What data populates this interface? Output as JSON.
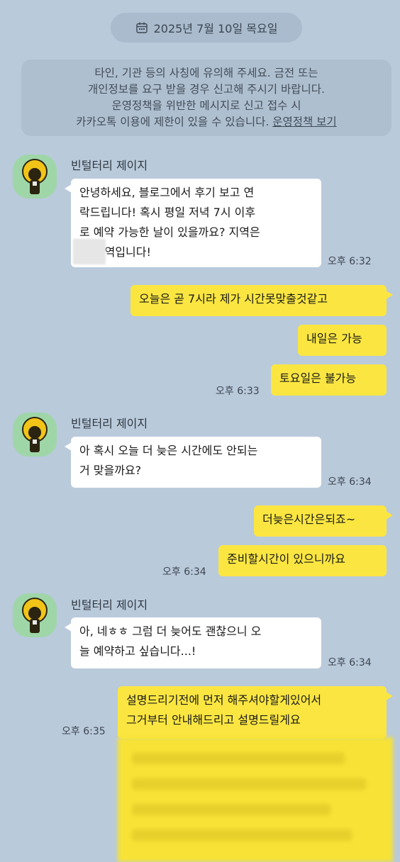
{
  "date_divider": "2025년 7월 10일 목요일",
  "notice": {
    "line1": "타인, 기관 등의 사칭에 유의해 주세요. 금전 또는",
    "line2": "개인정보를 요구 받을 경우 신고해 주시기 바랍니다.",
    "line3": "운영정책을 위반한 메시지로 신고 접수 시",
    "line4_prefix": "카카오톡 이용에 제한이 있을 수 있습니다. ",
    "link": "운영정책 보기"
  },
  "sender_name": "빈털터리 제이지",
  "messages": {
    "m1": {
      "text": "안녕하세요, 블로그에서 후기 보고 연\n락드립니다! 혹시 평일 저녁 7시 이후\n로 예약 가능한 날이 있을까요? 지역은\n       역입니다!",
      "time": "오후 6:32"
    },
    "m2": {
      "text": "오늘은 곧 7시라 제가 시간못맞출것같고"
    },
    "m3": {
      "text": "내일은 가능"
    },
    "m4": {
      "text": "토요일은 불가능",
      "time": "오후 6:33"
    },
    "m5": {
      "text": "아 혹시 오늘 더 늦은 시간에도 안되는\n거 맞을까요?",
      "time": "오후 6:34"
    },
    "m6": {
      "text": "더늦은시간은되죠~"
    },
    "m7": {
      "text": "준비할시간이 있으니까요",
      "time": "오후 6:34"
    },
    "m8": {
      "text": "아, 네ㅎㅎ 그럼 더 늦어도 괜찮으니 오\n늘 예약하고 싶습니다...!",
      "time": "오후 6:34"
    },
    "m9": {
      "text": "설명드리기전에 먼저 해주셔야할게있어서\n그거부터 안내해드리고 설명드릴게요",
      "time": "오후 6:35"
    }
  },
  "colors": {
    "background": "#b9cadb",
    "outgoing_bubble": "#fbe641",
    "incoming_bubble": "#ffffff",
    "avatar_bg": "#9fd6a8"
  }
}
